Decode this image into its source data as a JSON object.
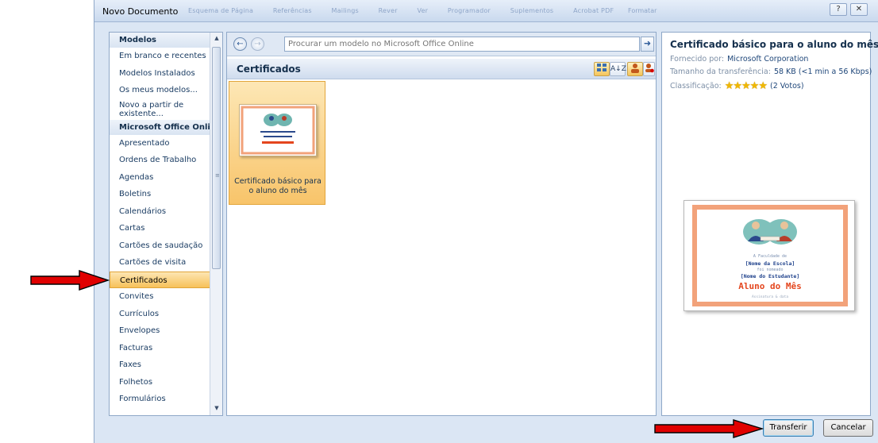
{
  "dialog": {
    "title": "Novo Documento",
    "ghost_tabs": [
      "Esquema de Página",
      "Referências",
      "Mailings",
      "Rever",
      "Ver",
      "Programador",
      "Suplementos",
      "Acrobat PDF"
    ],
    "ghost_right": "Formatar",
    "help_glyph": "?",
    "close_glyph": "✕"
  },
  "sidebar": {
    "section_models": "Modelos",
    "items_top": [
      "Em branco e recentes",
      "Modelos Instalados",
      "Os meus modelos...",
      "Novo a partir de existente..."
    ],
    "section_online": "Microsoft Office Online",
    "items": [
      "Apresentado",
      "Ordens de Trabalho",
      "Agendas",
      "Boletins",
      "Calendários",
      "Cartas",
      "Cartões de saudação",
      "Cartões de visita",
      "Certificados",
      "Convites",
      "Currículos",
      "Envelopes",
      "Facturas",
      "Faxes",
      "Folhetos",
      "Formulários"
    ],
    "selected": "Certificados"
  },
  "search": {
    "placeholder": "Procurar um modelo no Microsoft Office Online",
    "back_glyph": "←",
    "forward_glyph": "→",
    "go_glyph": "➜"
  },
  "center": {
    "header_title": "Certificados",
    "sort_glyph": "A↓Z",
    "tile_label": "Certificado básico para o aluno do mês"
  },
  "details": {
    "title": "Certificado básico para o aluno do mês",
    "provider_label": "Fornecido por:",
    "provider_value": "Microsoft Corporation",
    "size_label": "Tamanho da transferência:",
    "size_value": "58 KB (<1 min a 56 Kbps)",
    "rating_label": "Classificação:",
    "rating_stars": "★★★★★",
    "rating_votes": "(2 Votos)"
  },
  "preview": {
    "small_top": "A Faculdade de",
    "school": "[Nome da Escola]",
    "student": "[Nome do Estudante]",
    "small_mid": "foi nomeado",
    "award": "Aluno do Mês",
    "small_bottom": "Assinatura & data"
  },
  "footer": {
    "primary_label": "Transferir",
    "cancel_label": "Cancelar"
  },
  "colors": {
    "arrow": "#e00000",
    "selection": "#f7c15a"
  }
}
